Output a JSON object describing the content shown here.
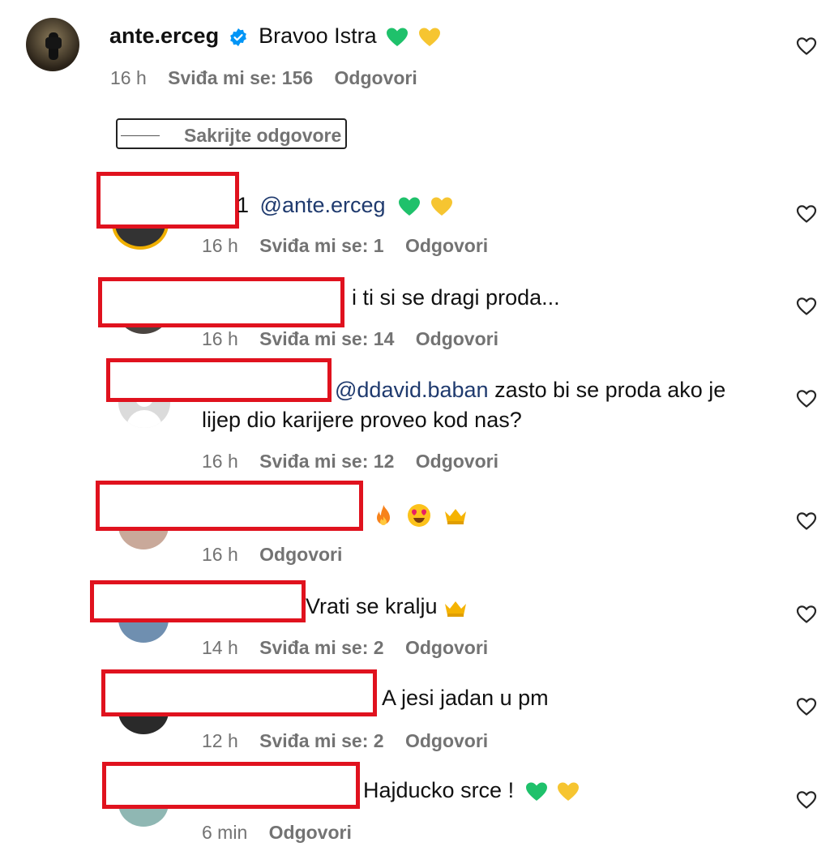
{
  "top_comment": {
    "username": "ante.erceg",
    "text": "Bravoo Istra",
    "time": "16 h",
    "likes": "Sviđa mi se: 156",
    "reply": "Odgovori"
  },
  "hide_replies": "Sakrijte odgovore",
  "replies": [
    {
      "fragment": "1",
      "mention": "@ante.erceg",
      "text": "",
      "time": "16 h",
      "likes": "Sviđa mi se: 1",
      "reply": "Odgovori"
    },
    {
      "text": "i ti si se dragi proda...",
      "time": "16 h",
      "likes": "Sviđa mi se: 14",
      "reply": "Odgovori"
    },
    {
      "mention": "@ddavid.baban",
      "text": " zasto bi se proda ako je",
      "text_line2": "lijep dio karijere proveo kod nas?",
      "time": "16 h",
      "likes": "Sviđa mi se: 12",
      "reply": "Odgovori"
    },
    {
      "text": "",
      "time": "16 h",
      "reply": "Odgovori"
    },
    {
      "text": "Vrati se kralju",
      "time": "14 h",
      "likes": "Sviđa mi se: 2",
      "reply": "Odgovori"
    },
    {
      "text": "A jesi jadan u pm",
      "time": "12 h",
      "likes": "Sviđa mi se: 2",
      "reply": "Odgovori"
    },
    {
      "text": "Hajducko srce !",
      "time": "6 min",
      "reply": "Odgovori"
    }
  ],
  "colors": {
    "redaction": "#e0121e",
    "mention": "#1f3a6e",
    "meta": "#737373",
    "verified": "#0095f6"
  }
}
